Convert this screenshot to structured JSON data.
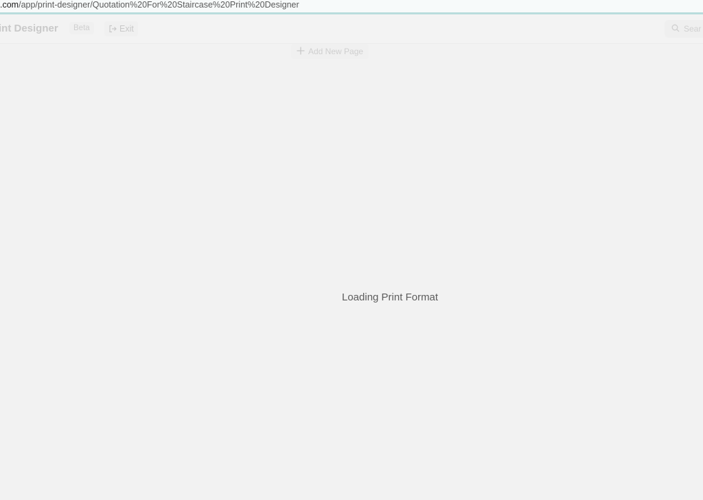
{
  "browser": {
    "url_domain": ".com",
    "url_path": "/app/print-designer/Quotation%20For%20Staircase%20Print%20Designer"
  },
  "header": {
    "title": "int Designer",
    "beta_label": "Beta",
    "exit_label": "Exit",
    "search_placeholder": "Sear"
  },
  "toolbar": {
    "add_page_label": "Add New Page"
  },
  "main": {
    "loading_text": "Loading Print Format"
  },
  "icons": {
    "exit": "exit-icon",
    "search": "search-icon",
    "add": "plus-icon"
  }
}
